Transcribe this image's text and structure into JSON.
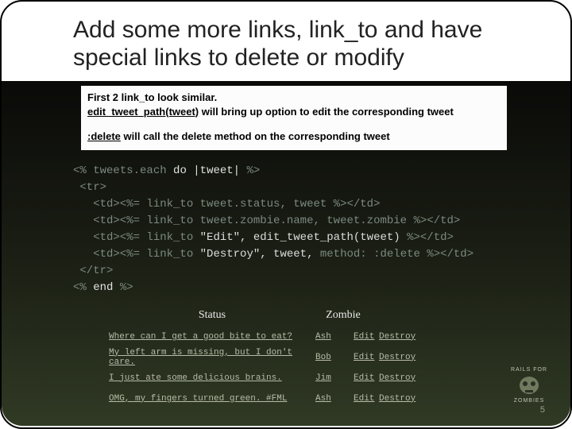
{
  "title": "Add some more links, link_to and have special links to delete or modify",
  "note": {
    "line1": "First 2 link_to look similar.",
    "edit_link": "edit_tweet_path(tweet)",
    "line2_rest": " will bring up option to edit the corresponding tweet",
    "delete_link": ":delete",
    "line3_rest": "  will call the delete method on the corresponding tweet"
  },
  "code": {
    "l1_a": "<% ",
    "l1_b": "tweets.each ",
    "l1_c": "do ",
    "l1_d": "|tweet| ",
    "l1_e": "%>",
    "l2": " <tr>",
    "l3_a": "   <td><%= ",
    "l3_b": "link_to ",
    "l3_c": "tweet.status, tweet ",
    "l3_d": "%></td>",
    "l4_a": "   <td><%= ",
    "l4_b": "link_to ",
    "l4_c": "tweet.zombie.name, tweet.zombie ",
    "l4_d": "%></td>",
    "l5_a": "   <td><%= ",
    "l5_b": "link_to ",
    "l5_c": "\"Edit\", edit_tweet_path(tweet) ",
    "l5_d": "%></td>",
    "l6_a": "   <td><%= ",
    "l6_b": "link_to ",
    "l6_c": "\"Destroy\", tweet, ",
    "l6_d": "method: :delete ",
    "l6_e": "%></td>",
    "l7": " </tr>",
    "l8_a": "<% ",
    "l8_b": "end ",
    "l8_c": "%>"
  },
  "table": {
    "header_status": "Status",
    "header_zombie": "Zombie",
    "rows": [
      {
        "status": "Where can I get a good bite to eat?",
        "zombie": "Ash",
        "edit": "Edit",
        "destroy": "Destroy"
      },
      {
        "status": "My left arm is missing, but I don't care.",
        "zombie": "Bob",
        "edit": "Edit",
        "destroy": "Destroy"
      },
      {
        "status": "I just ate some delicious brains.",
        "zombie": "Jim",
        "edit": "Edit",
        "destroy": "Destroy"
      },
      {
        "status": "OMG, my fingers turned green. #FML",
        "zombie": "Ash",
        "edit": "Edit",
        "destroy": "Destroy"
      }
    ]
  },
  "logo": {
    "top": "RAILS FOR",
    "bottom": "ZOMBIES"
  },
  "page_number": "5"
}
